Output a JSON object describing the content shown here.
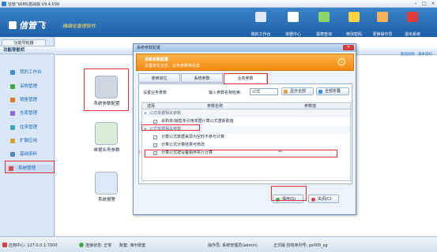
{
  "window": {
    "title": "信管飞RMS基础版 V9.4.599"
  },
  "banner": {
    "logo": "信管飞",
    "slogan": "精细化管理软件"
  },
  "toolbar": [
    {
      "label": "我的工作台",
      "icon": "monitor-icon",
      "color": "#dfe8f6"
    },
    {
      "label": "单据中心",
      "icon": "list-icon",
      "color": "#ffffff"
    },
    {
      "label": "报表查询",
      "icon": "document-icon",
      "color": "#8bd46a"
    },
    {
      "label": "修改密码",
      "icon": "lock-icon",
      "color": "#ffd23f"
    },
    {
      "label": "更换操作员",
      "icon": "user-icon",
      "color": "#ffb357"
    },
    {
      "label": "退出系统",
      "icon": "exit-icon",
      "color": "#e23b3b"
    }
  ],
  "sidebar": {
    "tab": "功能导航器",
    "header": "功能导航栏",
    "items": [
      {
        "label": "我的工作台",
        "icon_color": "#3d8fd8"
      },
      {
        "label": "采购管理",
        "icon_color": "#41a64a"
      },
      {
        "label": "销售管理",
        "icon_color": "#e07a2a"
      },
      {
        "label": "仓库管理",
        "icon_color": "#8b6bd3"
      },
      {
        "label": "往来管理",
        "icon_color": "#3aa4b8"
      },
      {
        "label": "扩展应用",
        "icon_color": "#d5a23a"
      },
      {
        "label": "基础资料",
        "icon_color": "#5b86c7"
      },
      {
        "label": "系统管理",
        "icon_color": "#d64b4b"
      }
    ]
  },
  "main": {
    "tablinks": "基础权限 · 基本资料"
  },
  "modules": [
    {
      "label": "系统参数配置",
      "icon": "database-gear-icon",
      "color": "#cfd6e0"
    },
    {
      "label": "单据业务参数",
      "icon": "chart-icon",
      "color": "#d8ecd7"
    },
    {
      "label": "系统报警",
      "icon": "clock-icon",
      "color": "#dbe8f7"
    }
  ],
  "dialog": {
    "title": "系统参数配置",
    "close": "✕",
    "head_title": "系统参数配置",
    "head_sub": "设置单位信息，业务参数等信息",
    "tabs": [
      "使用单位",
      "系统参数",
      "业务参数"
    ],
    "filter_label": "设置业务参数",
    "search_label": "输入参数名称检索:",
    "search_value": "公式",
    "btn_show_all": "显示全部",
    "btn_select_all": "全部折叠",
    "grid_headers": [
      "选择",
      "参数名称",
      "参数值"
    ],
    "rows": [
      {
        "type": "group",
        "name": "公式单据相关参数",
        "checked": false,
        "value": ""
      },
      {
        "type": "item",
        "name": "采购单/销售单引用单据计算公式重新取值",
        "checked": true,
        "value": ""
      },
      {
        "type": "group",
        "name": "公式单据相关参数",
        "checked": false,
        "value": ""
      },
      {
        "type": "item",
        "name": "计算公式数据来源为空时不参与计算",
        "checked": true,
        "value": ""
      },
      {
        "type": "item",
        "name": "计算公式计算结果可修改",
        "checked": true,
        "value": ""
      },
      {
        "type": "item",
        "name": "计算公式按设备顺序执行计算",
        "checked": true,
        "value": "**"
      }
    ],
    "save_label": "保存(S)",
    "close_label": "关闭(C)"
  },
  "statusbar": {
    "server": "应用中心: 127.0.0.1:7000",
    "conn": "连接状态: 正常",
    "account": "账套: 演示账套",
    "operator": "操作员: 系统管理员(admin)",
    "edition": "正式版  授权序列号: ps005_sg"
  }
}
